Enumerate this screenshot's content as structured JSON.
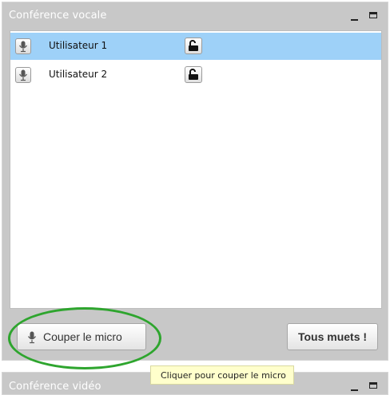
{
  "voice_panel": {
    "title": "Conférence vocale",
    "users": [
      {
        "label": "Utilisateur 1",
        "selected": true
      },
      {
        "label": "Utilisateur 2",
        "selected": false
      }
    ],
    "mute_mic_label": "Couper le micro",
    "mute_all_label": "Tous muets !"
  },
  "video_panel": {
    "title": "Conférence vidéo"
  },
  "tooltip": {
    "text": "Cliquer pour couper le micro"
  },
  "colors": {
    "panel_bg": "#c8c8c8",
    "selected_row": "#9ed1f8",
    "highlight_ring": "#2ea52e",
    "tooltip_bg": "#ffffcc"
  },
  "icons": {
    "mic": "microphone-icon",
    "lock": "unlocked-padlock-icon",
    "minimize": "minimize-icon",
    "maximize": "maximize-icon"
  }
}
